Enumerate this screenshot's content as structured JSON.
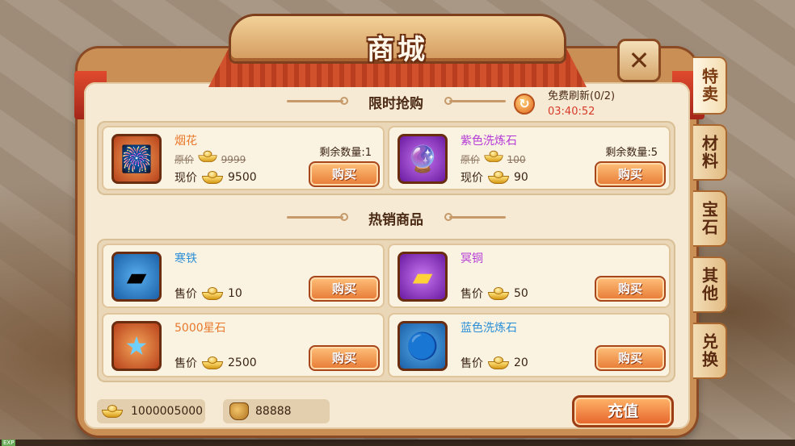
{
  "window": {
    "title": "商城",
    "close_icon": "close-icon"
  },
  "tabs": [
    {
      "label": "特卖",
      "active": true
    },
    {
      "label": "材料",
      "active": false
    },
    {
      "label": "宝石",
      "active": false
    },
    {
      "label": "其他",
      "active": false
    },
    {
      "label": "兑换",
      "active": false
    }
  ],
  "flash_sale": {
    "title": "限时抢购",
    "refresh_label": "免费刷新(0/2)",
    "countdown": "03:40:52",
    "items": [
      {
        "name": "烟花",
        "name_color": "#e8782b",
        "orig_label": "原价",
        "orig_price": "9999",
        "now_label": "现价",
        "now_price": "9500",
        "remain": "剩余数量:1",
        "buy": "购买",
        "icon": "fireworks-icon"
      },
      {
        "name": "紫色洗炼石",
        "name_color": "#b43ad6",
        "orig_label": "原价",
        "orig_price": "100",
        "now_label": "现价",
        "now_price": "90",
        "remain": "剩余数量:5",
        "buy": "购买",
        "icon": "purple-stone-icon"
      }
    ]
  },
  "hot_sale": {
    "title": "热销商品",
    "items": [
      {
        "name": "寒铁",
        "name_color": "#2a8ed6",
        "price_label": "售价",
        "price": "10",
        "buy": "购买",
        "icon": "cold-iron-icon"
      },
      {
        "name": "冥铜",
        "name_color": "#b43ad6",
        "price_label": "售价",
        "price": "50",
        "buy": "购买",
        "icon": "dark-copper-icon"
      },
      {
        "name": "5000星石",
        "name_color": "#e8782b",
        "price_label": "售价",
        "price": "2500",
        "buy": "购买",
        "icon": "star-stone-icon"
      },
      {
        "name": "蓝色洗炼石",
        "name_color": "#2a8ed6",
        "price_label": "售价",
        "price": "20",
        "buy": "购买",
        "icon": "blue-stone-icon"
      }
    ]
  },
  "footer": {
    "ingot_balance": "1000005000",
    "bound_balance": "88888",
    "recharge": "充值"
  },
  "colors": {
    "accent": "#e67a35",
    "panel": "#f6ead4",
    "frame": "#c98f54"
  }
}
